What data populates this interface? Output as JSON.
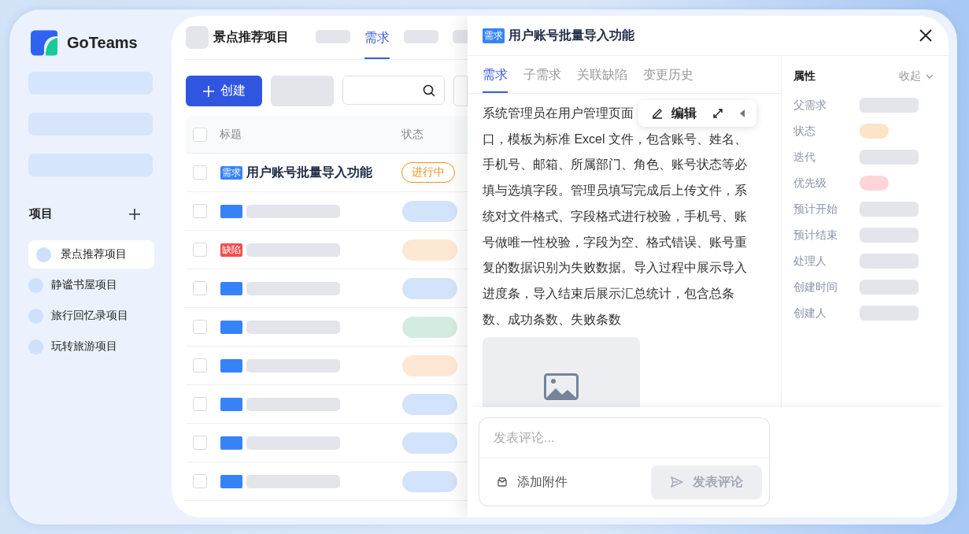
{
  "logo": {
    "name": "GoTeams"
  },
  "sidebar": {
    "section_title": "项目",
    "projects": [
      {
        "name": "景点推荐项目",
        "selected": true
      },
      {
        "name": "静谧书屋项目",
        "selected": false
      },
      {
        "name": "旅行回忆录项目",
        "selected": false
      },
      {
        "name": "玩转旅游项目",
        "selected": false
      }
    ]
  },
  "header": {
    "title": "景点推荐项目",
    "tabs": [
      {
        "kind": "skeleton",
        "selected": false
      },
      {
        "kind": "text",
        "label": "需求",
        "selected": true
      },
      {
        "kind": "skeleton",
        "selected": false
      },
      {
        "kind": "skeleton",
        "selected": false
      }
    ]
  },
  "toolbar": {
    "create_button": "创建"
  },
  "table": {
    "all_checked": false,
    "columns": [
      "标题",
      "状态"
    ],
    "rows": [
      {
        "kind": "text",
        "tag": {
          "label": "需求",
          "color": "#3683f7"
        },
        "title": "用户账号批量导入功能",
        "status": {
          "label": "进行中",
          "color": "#f0901e"
        },
        "checked": false
      },
      {
        "kind": "skeleton",
        "tag": {
          "color": "#3683f7"
        },
        "status": {
          "color": "#d3e3fb"
        },
        "checked": false
      },
      {
        "kind": "skeleton",
        "tag": {
          "label": "缺陷",
          "color": "#f04e4e"
        },
        "status": {
          "color": "#fde8d4"
        },
        "checked": false
      },
      {
        "kind": "skeleton",
        "tag": {
          "color": "#3683f7"
        },
        "status": {
          "color": "#d3e3fb"
        },
        "checked": false
      },
      {
        "kind": "skeleton",
        "tag": {
          "color": "#3683f7"
        },
        "status": {
          "color": "#d4ecdf"
        },
        "checked": false
      },
      {
        "kind": "skeleton",
        "tag": {
          "color": "#3683f7"
        },
        "status": {
          "color": "#fde8d4"
        },
        "checked": false
      },
      {
        "kind": "skeleton",
        "tag": {
          "color": "#3683f7"
        },
        "status": {
          "color": "#d3e3fb"
        },
        "checked": false
      },
      {
        "kind": "skeleton",
        "tag": {
          "color": "#3683f7"
        },
        "status": {
          "color": "#d3e3fb"
        },
        "checked": false
      },
      {
        "kind": "skeleton",
        "tag": {
          "color": "#3683f7"
        },
        "status": {
          "color": "#d3e3fb"
        },
        "checked": false
      }
    ]
  },
  "drawer": {
    "tag": "需求",
    "title": "用户账号批量导入功能",
    "tabs": [
      {
        "label": "需求",
        "selected": true
      },
      {
        "label": "子需求",
        "selected": false
      },
      {
        "label": "关联缺陷",
        "selected": false
      },
      {
        "label": "变更历史",
        "selected": false
      }
    ],
    "description": {
      "first_line": "系统管理员在用户管理页面",
      "rest_lines": [
        "口，模板为标准 Excel 文件，包含账号、姓名、",
        "手机号、邮箱、所属部门、角色、账号状态等必",
        "填与选填字段。管理员填写完成后上传文件，系",
        "统对文件格式、字段格式进行校验，手机号、账",
        "号做唯一性校验，字段为空、格式错误、账号重",
        "复的数据识别为失败数据。导入过程中展示导入",
        "进度条，导入结束后展示汇总统计，包含总条",
        "数、成功条数、失败条数"
      ]
    },
    "edit_button": "编辑",
    "properties": {
      "title": "属性",
      "collapse": "收起",
      "fields": [
        {
          "label": "父需求",
          "kind": "bar",
          "color": "#e4e5ea"
        },
        {
          "label": "状态",
          "kind": "pill",
          "color": "#fde3c7"
        },
        {
          "label": "迭代",
          "kind": "bar",
          "color": "#e4e5ea"
        },
        {
          "label": "优先级",
          "kind": "pill",
          "color": "#fdd5d7"
        },
        {
          "label": "预计开始",
          "kind": "bar",
          "color": "#e4e5ea"
        },
        {
          "label": "预计结束",
          "kind": "bar",
          "color": "#e4e5ea"
        },
        {
          "label": "处理人",
          "kind": "bar",
          "color": "#e4e5ea"
        },
        {
          "label": "创建时间",
          "kind": "bar",
          "color": "#e4e5ea"
        },
        {
          "label": "创建人",
          "kind": "bar",
          "color": "#e4e5ea"
        }
      ]
    },
    "comment": {
      "placeholder": "发表评论...",
      "attach": "添加附件",
      "submit": "发表评论",
      "submit_disabled": true
    }
  }
}
